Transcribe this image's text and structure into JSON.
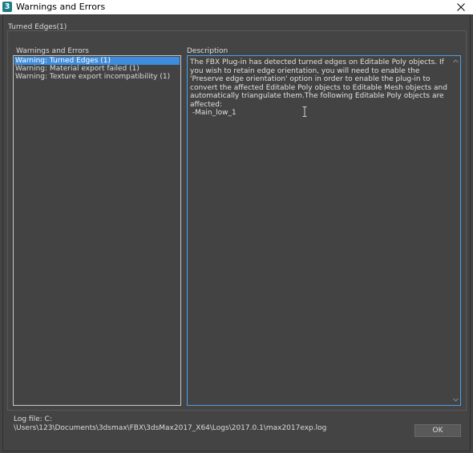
{
  "window": {
    "title": "Warnings and Errors",
    "app_icon_label": "3",
    "close_icon": "close-icon"
  },
  "group": {
    "label": "Turned Edges(1)"
  },
  "left_panel": {
    "label": "Warnings and Errors",
    "items": [
      {
        "label": "Warning: Turned Edges (1)",
        "selected": true
      },
      {
        "label": "Warning: Material export failed (1)",
        "selected": false
      },
      {
        "label": "Warning: Texture export incompatibility (1)",
        "selected": false
      }
    ]
  },
  "right_panel": {
    "label": "Description",
    "text": "The FBX Plug-in has detected turned edges on Editable Poly objects. If you wish to retain edge orientation, you will need to enable the 'Preserve edge orientation' option in order to enable the plug-in to convert the affected Editable Poly objects to Editable Mesh objects and automatically triangulate them.The following Editable Poly objects are affected:\n -Main_low_1"
  },
  "footer": {
    "log_label": "Log file: C:",
    "log_path": "\\Users\\123\\Documents\\3dsmax\\FBX\\3dsMax2017_X64\\Logs\\2017.0.1\\max2017exp.log",
    "ok_label": "OK"
  },
  "colors": {
    "background": "#444444",
    "selection": "#3e8cdc",
    "focus_border": "#4aa0e6"
  }
}
